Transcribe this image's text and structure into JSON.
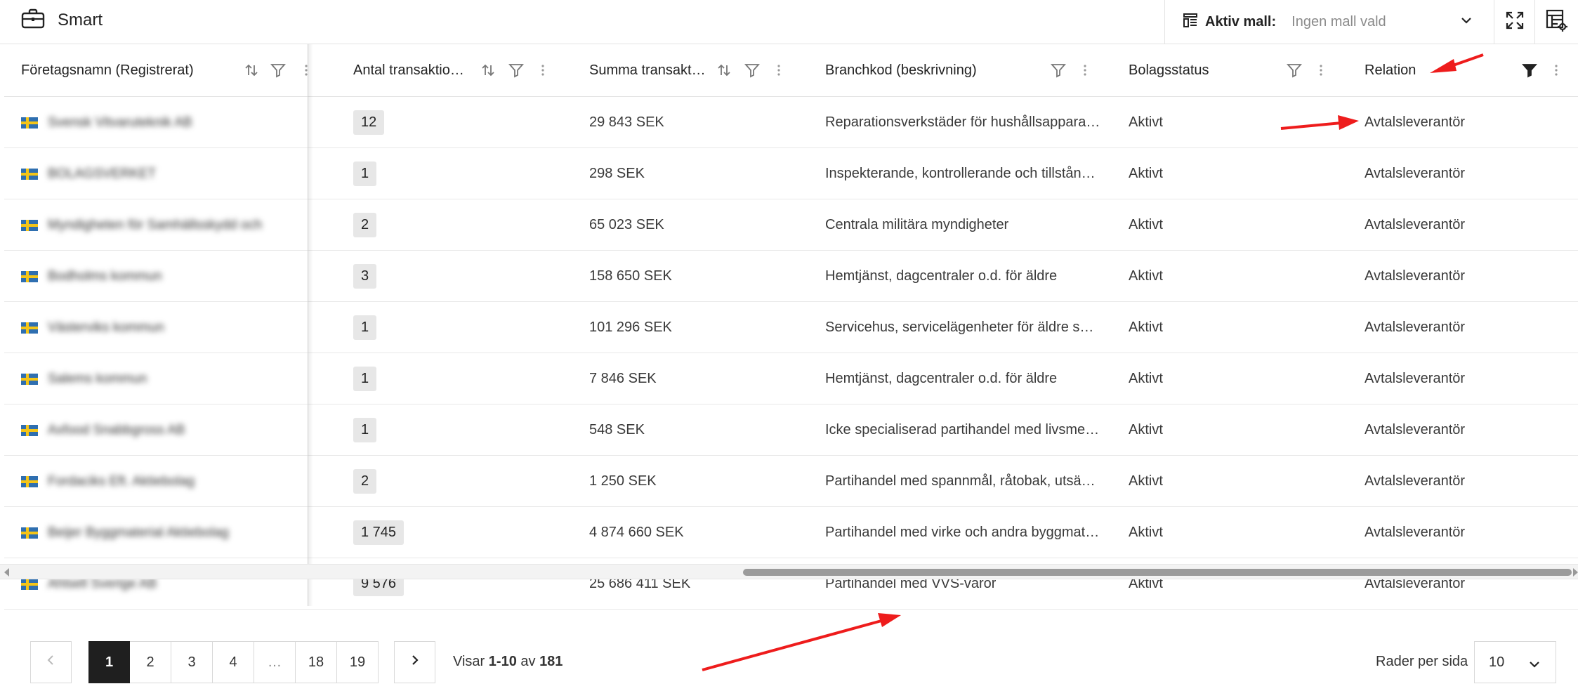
{
  "app": {
    "title": "Smart",
    "icon": "briefcase-icon"
  },
  "toolbar": {
    "template_label": "Aktiv mall:",
    "template_value": "Ingen mall vald",
    "template_icon": "template-list-icon",
    "fullscreen_icon": "expand-icon",
    "columns_icon": "table-settings-icon"
  },
  "table": {
    "columns": [
      {
        "label": "Företagsnamn (Registrerat)",
        "sortable": true,
        "filterable": true
      },
      {
        "label": "Antal transaktio…",
        "sortable": true,
        "filterable": true
      },
      {
        "label": "Summa transakt…",
        "sortable": true,
        "filterable": true
      },
      {
        "label": "Branchkod (beskrivning)",
        "sortable": false,
        "filterable": true
      },
      {
        "label": "Bolagsstatus",
        "sortable": false,
        "filterable": true
      },
      {
        "label": "Relation",
        "sortable": false,
        "filterable": true,
        "filter_active": true
      }
    ],
    "rows": [
      {
        "name": "Svensk Vitvaruteknik AB",
        "count": "12",
        "sum": "29 843 SEK",
        "branch": "Reparationsverkstäder för hushållsapparat…",
        "status": "Aktivt",
        "relation": "Avtalsleverantör"
      },
      {
        "name": "BOLAGSVERKET",
        "count": "1",
        "sum": "298 SEK",
        "branch": "Inspekterande, kontrollerande och tillstånd…",
        "status": "Aktivt",
        "relation": "Avtalsleverantör"
      },
      {
        "name": "Myndigheten för Samhällsskydd och",
        "count": "2",
        "sum": "65 023 SEK",
        "branch": "Centrala militära myndigheter",
        "status": "Aktivt",
        "relation": "Avtalsleverantör"
      },
      {
        "name": "Bodholms kommun",
        "count": "3",
        "sum": "158 650 SEK",
        "branch": "Hemtjänst, dagcentraler o.d. för äldre",
        "status": "Aktivt",
        "relation": "Avtalsleverantör"
      },
      {
        "name": "Västerviks kommun",
        "count": "1",
        "sum": "101 296 SEK",
        "branch": "Servicehus, servicelägenheter för äldre sa…",
        "status": "Aktivt",
        "relation": "Avtalsleverantör"
      },
      {
        "name": "Salems kommun",
        "count": "1",
        "sum": "7 846 SEK",
        "branch": "Hemtjänst, dagcentraler o.d. för äldre",
        "status": "Aktivt",
        "relation": "Avtalsleverantör"
      },
      {
        "name": "Axfood Snabbgross AB",
        "count": "1",
        "sum": "548 SEK",
        "branch": "Icke specialiserad partihandel med livsme…",
        "status": "Aktivt",
        "relation": "Avtalsleverantör"
      },
      {
        "name": "Fordaciks Eft. Aktiebolag",
        "count": "2",
        "sum": "1 250 SEK",
        "branch": "Partihandel med spannmål, råtobak, utsäd…",
        "status": "Aktivt",
        "relation": "Avtalsleverantör"
      },
      {
        "name": "Beijer Byggmaterial Aktiebolag",
        "count": "1 745",
        "sum": "4 874 660 SEK",
        "branch": "Partihandel med virke och andra byggmate…",
        "status": "Aktivt",
        "relation": "Avtalsleverantör"
      },
      {
        "name": "Ahlsell Sverige AB",
        "count": "9 576",
        "sum": "25 686 411 SEK",
        "branch": "Partihandel med VVS-varor",
        "status": "Aktivt",
        "relation": "Avtalsleverantör"
      }
    ]
  },
  "pagination": {
    "pages": [
      "1",
      "2",
      "3",
      "4",
      "…",
      "18",
      "19"
    ],
    "current": "1",
    "showing_prefix": "Visar",
    "showing_range": "1-10",
    "showing_of": "av",
    "showing_total": "181",
    "rows_per_page_label": "Rader per sida",
    "rows_per_page_value": "10"
  },
  "colors": {
    "annotation_arrow": "#ee1c1c",
    "active_page": "#1f1f1f",
    "badge_bg": "#e7e7e7"
  }
}
